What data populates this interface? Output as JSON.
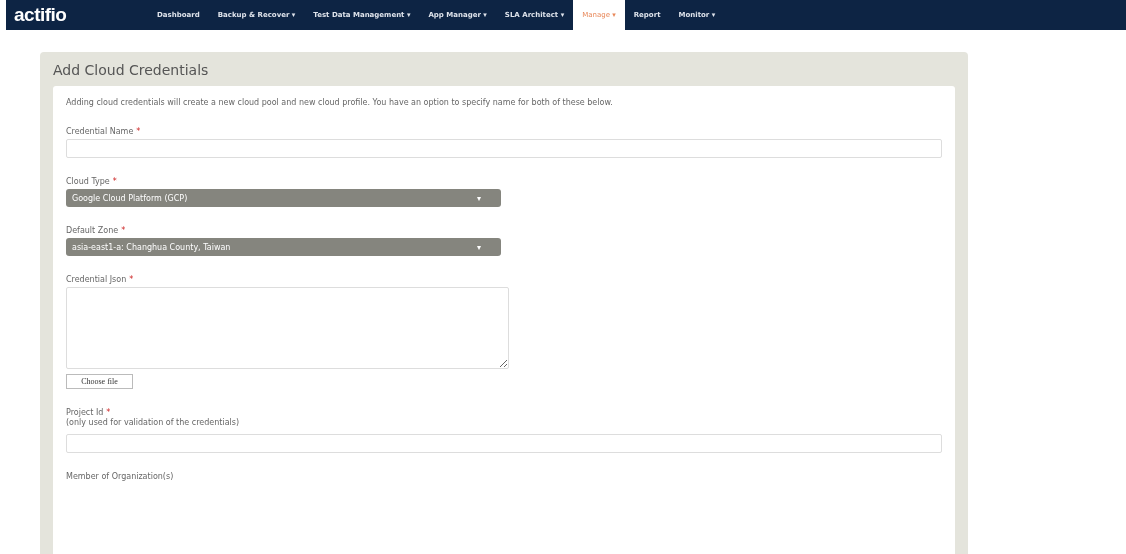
{
  "nav": {
    "logo": "actifio",
    "items": [
      {
        "label": "Dashboard",
        "selected": false
      },
      {
        "label": "Backup & Recover ▾",
        "selected": false
      },
      {
        "label": "Test Data Management ▾",
        "selected": false
      },
      {
        "label": "App Manager ▾",
        "selected": false
      },
      {
        "label": "SLA Architect ▾",
        "selected": false
      },
      {
        "label": "Manage ▾",
        "selected": true
      },
      {
        "label": "Report",
        "selected": false
      },
      {
        "label": "Monitor ▾",
        "selected": false
      }
    ]
  },
  "panel": {
    "title": "Add Cloud Credentials",
    "intro": "Adding cloud credentials will create a new cloud pool and new cloud profile. You have an option to specify name for both of these below.",
    "fields": [
      {
        "kind": "input",
        "label": "Credential Name",
        "required_mark": "*"
      },
      {
        "kind": "select",
        "label": "Cloud Type",
        "required_mark": "*",
        "value": "Google Cloud Platform (GCP)",
        "caret": "▾"
      },
      {
        "kind": "select",
        "label": "Default Zone",
        "required_mark": "*",
        "value": "asia-east1-a: Changhua County, Taiwan",
        "caret": "▾"
      },
      {
        "kind": "textarea",
        "label": "Credential Json",
        "required_mark": "*",
        "button": "Choose file"
      },
      {
        "kind": "input",
        "label": "Project Id",
        "required_mark": "*",
        "hint": "(only used for validation of the credentials)"
      },
      {
        "kind": "heading",
        "label": "Member of Organization(s)"
      }
    ]
  }
}
